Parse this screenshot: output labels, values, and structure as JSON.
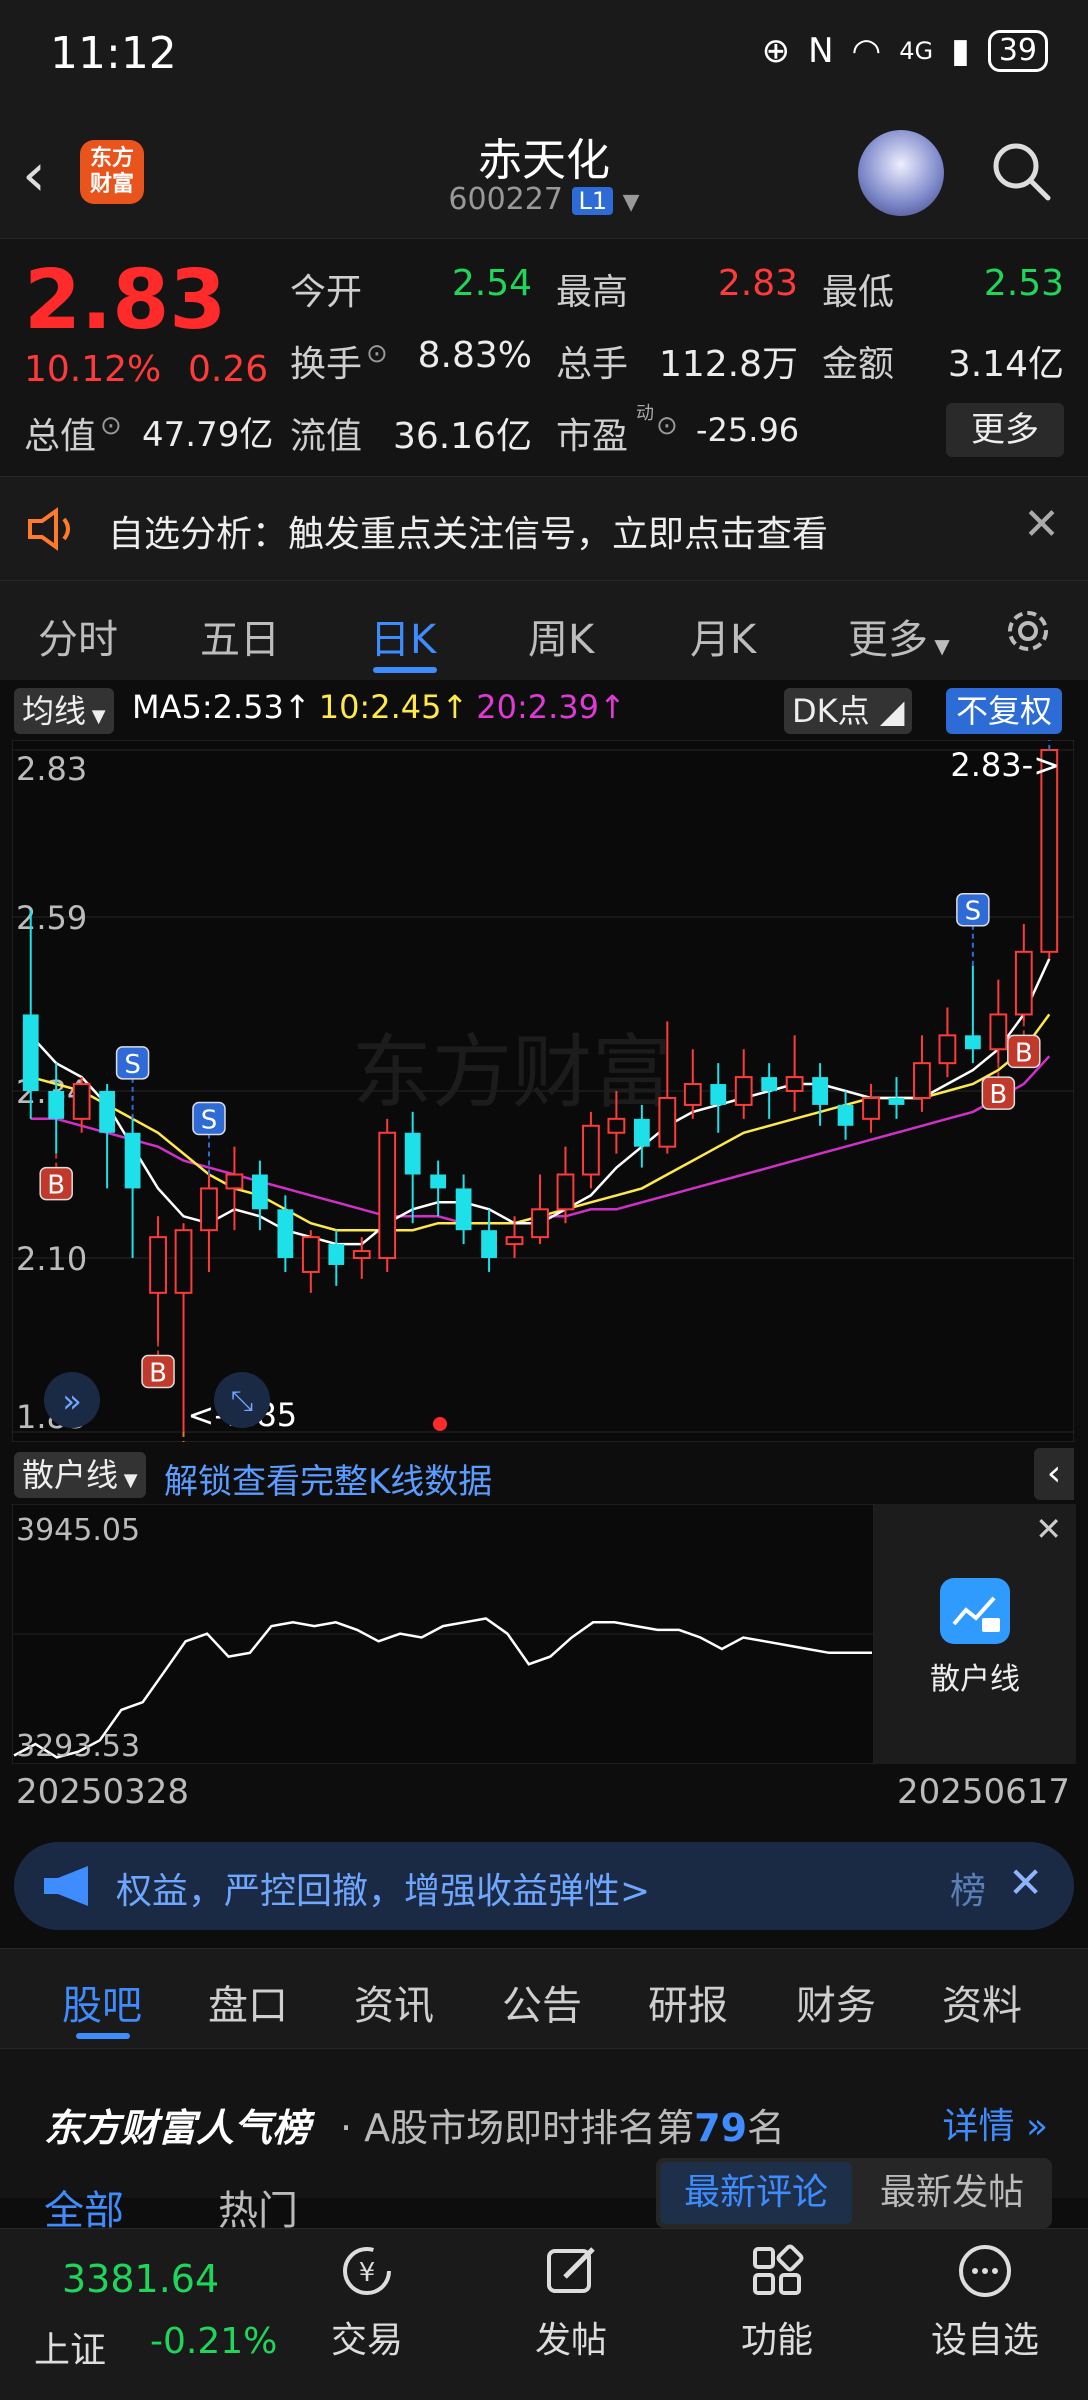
{
  "status_bar": {
    "time": "11:12",
    "network": "4G",
    "battery": "39"
  },
  "header": {
    "logo_text": "东方财富",
    "stock_name": "赤天化",
    "stock_code": "600227",
    "level_badge": "L1"
  },
  "quote": {
    "price": "2.83",
    "change_pct": "10.12%",
    "change": "0.26",
    "fields": [
      {
        "label": "今开",
        "value": "2.54",
        "color": "green"
      },
      {
        "label": "最高",
        "value": "2.83",
        "color": "red"
      },
      {
        "label": "最低",
        "value": "2.53",
        "color": "green"
      },
      {
        "label": "换手",
        "value": "8.83%",
        "color": "white"
      },
      {
        "label": "总手",
        "value": "112.8万",
        "color": "white"
      },
      {
        "label": "金额",
        "value": "3.14亿",
        "color": "white"
      },
      {
        "label": "总值",
        "value": "47.79亿",
        "color": "white"
      },
      {
        "label": "流值",
        "value": "36.16亿",
        "color": "white"
      },
      {
        "label": "市盈",
        "value": "-25.96",
        "color": "white"
      }
    ],
    "pe_superscript": "动",
    "more_label": "更多"
  },
  "notice": {
    "text": "自选分析：触发重点关注信号，立即点击查看"
  },
  "ktabs": [
    "分时",
    "五日",
    "日K",
    "周K",
    "月K",
    "更多"
  ],
  "chart_header": {
    "indicator": "均线",
    "ma5": "MA5:2.53",
    "ma10": "10:2.45",
    "ma20": "20:2.39",
    "dk_label": "DK点",
    "adjust_label": "不复权",
    "arrow": "↑"
  },
  "chart_data": {
    "type": "candlestick",
    "y_ticks": [
      "2.83",
      "2.59",
      "2.34",
      "2.10",
      "1.85"
    ],
    "ylim": [
      1.85,
      2.83
    ],
    "watermark": "东方财富",
    "high_marker": "2.83->",
    "low_marker": "<-1.85",
    "signals": {
      "B": [
        1,
        5,
        38,
        39
      ],
      "S": [
        4,
        7,
        37,
        40
      ],
      "T": [
        6
      ]
    },
    "candles": [
      [
        2.45,
        2.34,
        2.6,
        2.3
      ],
      [
        2.34,
        2.3,
        2.38,
        2.25
      ],
      [
        2.3,
        2.35,
        2.36,
        2.28
      ],
      [
        2.34,
        2.28,
        2.35,
        2.2
      ],
      [
        2.28,
        2.2,
        2.3,
        2.1
      ],
      [
        2.05,
        2.13,
        2.16,
        1.98
      ],
      [
        2.05,
        2.14,
        2.15,
        1.85
      ],
      [
        2.14,
        2.2,
        2.22,
        2.08
      ],
      [
        2.2,
        2.22,
        2.26,
        2.14
      ],
      [
        2.22,
        2.17,
        2.24,
        2.14
      ],
      [
        2.17,
        2.1,
        2.19,
        2.08
      ],
      [
        2.08,
        2.13,
        2.14,
        2.05
      ],
      [
        2.12,
        2.09,
        2.14,
        2.06
      ],
      [
        2.1,
        2.11,
        2.13,
        2.07
      ],
      [
        2.1,
        2.28,
        2.3,
        2.08
      ],
      [
        2.28,
        2.22,
        2.31,
        2.15
      ],
      [
        2.22,
        2.2,
        2.24,
        2.16
      ],
      [
        2.2,
        2.14,
        2.22,
        2.12
      ],
      [
        2.14,
        2.1,
        2.17,
        2.08
      ],
      [
        2.12,
        2.13,
        2.16,
        2.1
      ],
      [
        2.13,
        2.17,
        2.22,
        2.12
      ],
      [
        2.17,
        2.22,
        2.26,
        2.15
      ],
      [
        2.22,
        2.29,
        2.31,
        2.2
      ],
      [
        2.28,
        2.3,
        2.34,
        2.25
      ],
      [
        2.3,
        2.26,
        2.32,
        2.23
      ],
      [
        2.26,
        2.33,
        2.44,
        2.25
      ],
      [
        2.32,
        2.35,
        2.4,
        2.3
      ],
      [
        2.35,
        2.32,
        2.38,
        2.28
      ],
      [
        2.32,
        2.36,
        2.4,
        2.3
      ],
      [
        2.36,
        2.34,
        2.38,
        2.3
      ],
      [
        2.34,
        2.36,
        2.42,
        2.31
      ],
      [
        2.36,
        2.32,
        2.38,
        2.29
      ],
      [
        2.32,
        2.29,
        2.34,
        2.27
      ],
      [
        2.3,
        2.33,
        2.35,
        2.28
      ],
      [
        2.33,
        2.32,
        2.36,
        2.3
      ],
      [
        2.33,
        2.38,
        2.42,
        2.31
      ],
      [
        2.38,
        2.42,
        2.46,
        2.36
      ],
      [
        2.42,
        2.4,
        2.52,
        2.38
      ],
      [
        2.4,
        2.45,
        2.5,
        2.38
      ],
      [
        2.45,
        2.54,
        2.58,
        2.44
      ],
      [
        2.54,
        2.83,
        2.83,
        2.53
      ]
    ],
    "ma5": [
      2.42,
      2.38,
      2.36,
      2.32,
      2.26,
      2.2,
      2.16,
      2.15,
      2.17,
      2.16,
      2.14,
      2.13,
      2.12,
      2.12,
      2.15,
      2.17,
      2.18,
      2.18,
      2.17,
      2.15,
      2.15,
      2.17,
      2.19,
      2.23,
      2.26,
      2.29,
      2.31,
      2.32,
      2.33,
      2.34,
      2.35,
      2.35,
      2.34,
      2.33,
      2.33,
      2.33,
      2.35,
      2.37,
      2.4,
      2.45,
      2.53
    ],
    "ma10": [
      2.36,
      2.35,
      2.34,
      2.32,
      2.3,
      2.28,
      2.25,
      2.22,
      2.2,
      2.19,
      2.17,
      2.15,
      2.14,
      2.14,
      2.14,
      2.14,
      2.15,
      2.15,
      2.15,
      2.15,
      2.16,
      2.17,
      2.18,
      2.19,
      2.2,
      2.22,
      2.24,
      2.26,
      2.28,
      2.29,
      2.3,
      2.31,
      2.32,
      2.33,
      2.33,
      2.33,
      2.34,
      2.35,
      2.37,
      2.4,
      2.45
    ],
    "ma20": [
      2.3,
      2.3,
      2.29,
      2.28,
      2.27,
      2.26,
      2.24,
      2.23,
      2.22,
      2.21,
      2.2,
      2.19,
      2.18,
      2.17,
      2.16,
      2.16,
      2.16,
      2.15,
      2.15,
      2.15,
      2.16,
      2.16,
      2.17,
      2.17,
      2.18,
      2.19,
      2.2,
      2.21,
      2.22,
      2.23,
      2.24,
      2.25,
      2.26,
      2.27,
      2.28,
      2.29,
      2.3,
      2.31,
      2.33,
      2.35,
      2.39
    ]
  },
  "sub_chart": {
    "indicator": "散户线",
    "unlock_text": "解锁查看完整K线数据",
    "y_max": "3945.05",
    "y_min": "3293.53",
    "unlock_icon_label": "散户线",
    "values": [
      3300,
      3330,
      3295,
      3310,
      3340,
      3420,
      3440,
      3520,
      3600,
      3620,
      3560,
      3570,
      3640,
      3650,
      3640,
      3650,
      3630,
      3600,
      3620,
      3610,
      3640,
      3650,
      3660,
      3620,
      3540,
      3560,
      3610,
      3650,
      3650,
      3640,
      3630,
      3630,
      3610,
      3580,
      3610,
      3600,
      3590,
      3580,
      3570,
      3570,
      3570
    ]
  },
  "dates": {
    "start": "20250328",
    "end": "20250617"
  },
  "banner": {
    "text": "权益，严控回撤，增强收益弹性>",
    "tail": "榜"
  },
  "bottom_tabs": [
    "股吧",
    "盘口",
    "资讯",
    "公告",
    "研报",
    "财务",
    "资料"
  ],
  "rank": {
    "brand": "东方财富人气榜",
    "prefix": "· A股市场即时排名第",
    "rank_num": "79",
    "suffix": "名",
    "detail": "详情"
  },
  "sub_tabs": {
    "all": "全部",
    "hot": "热门",
    "latest_comment": "最新评论",
    "latest_post": "最新发帖"
  },
  "bottom_nav": {
    "index_value": "3381.64",
    "index_name": "上证",
    "index_pct": "-0.21%",
    "items": [
      "交易",
      "发帖",
      "功能",
      "设自选"
    ]
  }
}
